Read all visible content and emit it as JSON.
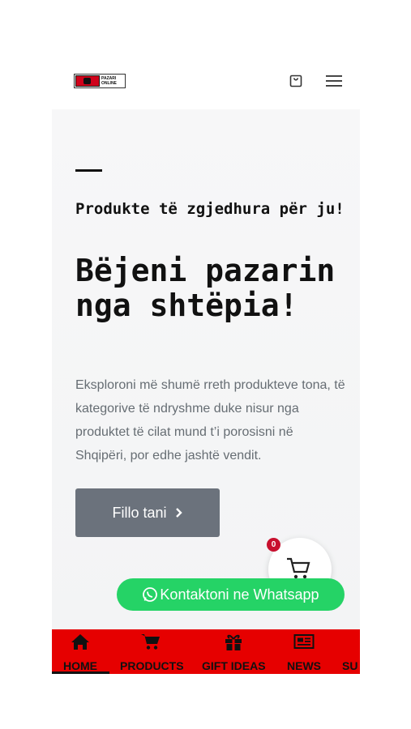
{
  "header": {
    "logo_text": "PAZARI ONLINE",
    "icons": [
      "shopping-bag-icon",
      "hamburger-menu-icon"
    ]
  },
  "hero": {
    "eyebrow": "Produkte të zgjedhura për ju!",
    "title": "Bëjeni pazarin nga shtëpia!",
    "body": "Eksploroni më shumë rreth produkteve tona, të kategorive të ndryshme duke nisur nga produktet të cilat mund t’i porosisni në Shqipëri, por edhe jashtë vendit.",
    "cta_label": "Fillo tani"
  },
  "cart": {
    "count": "0"
  },
  "whatsapp": {
    "label": "Kontaktoni ne Whatsapp"
  },
  "bottom_nav": {
    "items": [
      {
        "label": "HOME",
        "icon": "home-icon",
        "active": true
      },
      {
        "label": "PRODUCTS",
        "icon": "cart-icon"
      },
      {
        "label": "GIFT IDEAS",
        "icon": "gift-icon"
      },
      {
        "label": "NEWS",
        "icon": "newspaper-icon"
      },
      {
        "label": "SU",
        "icon": "support-icon"
      }
    ]
  },
  "colors": {
    "nav_bg": "#e60000",
    "cta_bg": "#6b727c",
    "whatsapp": "#25d366",
    "badge": "#c8102e"
  }
}
